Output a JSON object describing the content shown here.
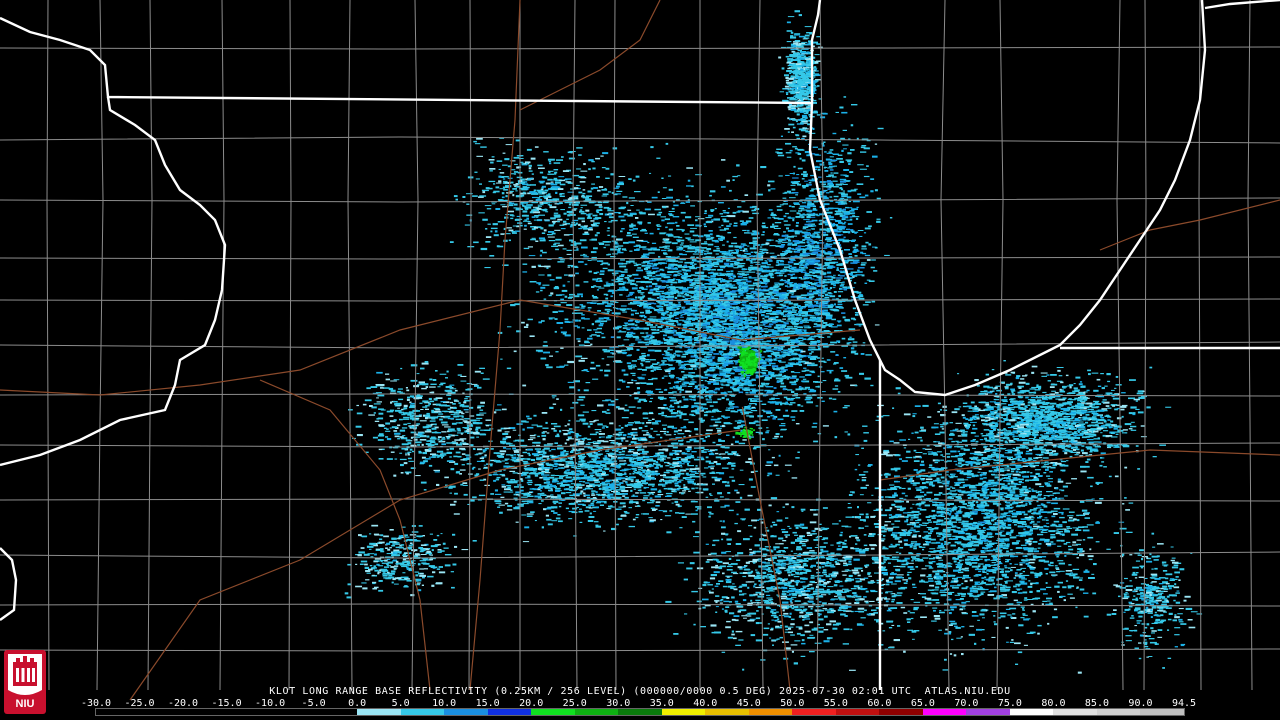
{
  "product": {
    "caption": "KLOT LONG RANGE BASE REFLECTIVITY (0.25KM / 256 LEVEL) (000000/0000 0.5 DEG) 2025-07-30 02:01 UTC  ATLAS.NIU.EDU",
    "station": "KLOT",
    "timestamp": "2025-07-30 02:01 UTC",
    "source": "ATLAS.NIU.EDU"
  },
  "logo": {
    "text": "NIU",
    "color": "#c8102e"
  },
  "scale": {
    "labels": [
      "-30.0",
      "-25.0",
      "-20.0",
      "-15.0",
      "-10.0",
      "-5.0",
      "0.0",
      "5.0",
      "10.0",
      "15.0",
      "20.0",
      "25.0",
      "30.0",
      "35.0",
      "40.0",
      "45.0",
      "50.0",
      "55.0",
      "60.0",
      "65.0",
      "70.0",
      "75.0",
      "80.0",
      "85.0",
      "90.0",
      "94.5"
    ],
    "colors": [
      "#000000",
      "#000000",
      "#000000",
      "#000000",
      "#000000",
      "#000000",
      "#9be6f5",
      "#35c9e8",
      "#1a8fe0",
      "#1030e0",
      "#10e020",
      "#0eb012",
      "#0a7a0c",
      "#f0f000",
      "#e8c000",
      "#f09000",
      "#f02020",
      "#c01010",
      "#900000",
      "#ff00ff",
      "#a040e0",
      "#ffffff",
      "#e0e0e0",
      "#d0d0d0",
      "#c0c0c0"
    ]
  },
  "map": {
    "colors": {
      "background": "#000000",
      "state_border": "#ffffff",
      "county_line": "#8c8c8c",
      "highway": "#8b4a2b"
    }
  }
}
